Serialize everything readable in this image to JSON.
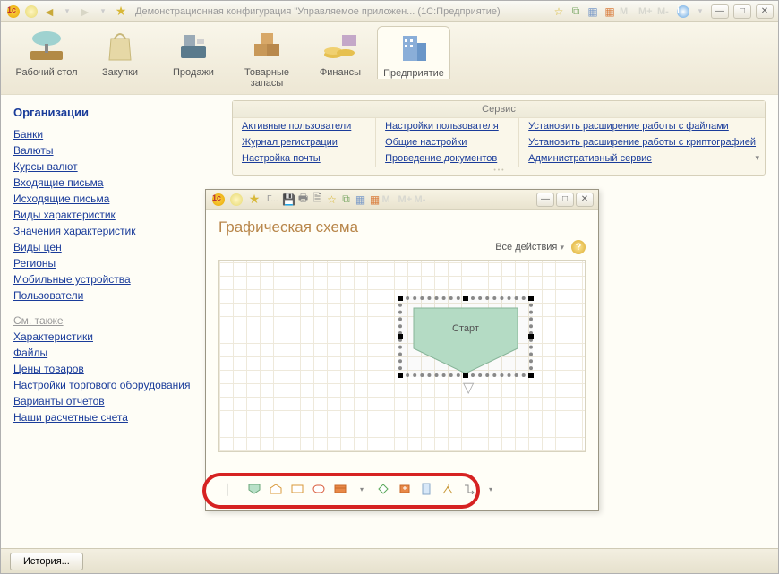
{
  "titlebar": {
    "title": "Демонстрационная конфигурация \"Управляемое приложен... (1С:Предприятие)",
    "m_labels": [
      "M",
      "M+",
      "M-"
    ]
  },
  "sections": [
    {
      "label": "Рабочий стол"
    },
    {
      "label": "Закупки"
    },
    {
      "label": "Продажи"
    },
    {
      "label": "Товарные запасы"
    },
    {
      "label": "Финансы"
    },
    {
      "label": "Предприятие"
    }
  ],
  "sidebar": {
    "title": "Организации",
    "links": [
      "Банки",
      "Валюты",
      "Курсы валют",
      "Входящие письма",
      "Исходящие письма",
      "Виды характеристик",
      "Значения характеристик",
      "Виды цен",
      "Регионы",
      "Мобильные устройства",
      "Пользователи"
    ],
    "see_also_label": "См. также",
    "see_also": [
      "Характеристики",
      "Файлы",
      "Цены товаров",
      "Настройки торгового оборудования",
      "Варианты отчетов",
      "Наши расчетные счета"
    ]
  },
  "service": {
    "title": "Сервис",
    "cols": [
      [
        "Активные пользователи",
        "Журнал регистрации",
        "Настройка почты"
      ],
      [
        "Настройки пользователя",
        "Общие настройки",
        "Проведение документов"
      ],
      [
        "Установить расширение работы с файлами",
        "Установить расширение работы с криптографией",
        "Административный сервис"
      ]
    ]
  },
  "childwin": {
    "title_prefix": "Г...",
    "heading": "Графическая схема",
    "all_actions": "Все действия",
    "start_label": "Старт",
    "m_labels": [
      "M",
      "M+",
      "M-"
    ]
  },
  "statusbar": {
    "history": "История..."
  }
}
